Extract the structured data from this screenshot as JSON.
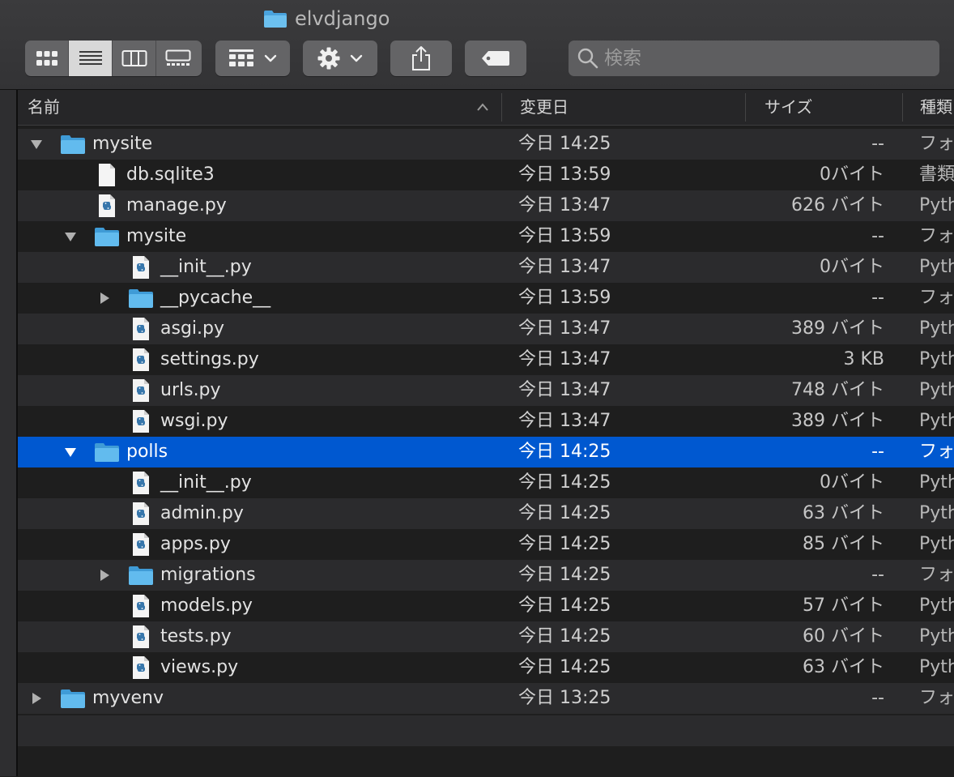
{
  "window": {
    "title": "elvdjango"
  },
  "search": {
    "placeholder": "検索"
  },
  "columns": {
    "name": "名前",
    "date": "変更日",
    "size": "サイズ",
    "kind": "種類"
  },
  "rows": [
    {
      "name": "mysite",
      "date": "今日 14:25",
      "size": "--",
      "kind": "フォルダ",
      "type": "folder",
      "depth": 0,
      "disclosure": "open"
    },
    {
      "name": "db.sqlite3",
      "date": "今日 13:59",
      "size": "0バイト",
      "kind": "書類",
      "type": "document",
      "depth": 1,
      "disclosure": ""
    },
    {
      "name": "manage.py",
      "date": "今日 13:47",
      "size": "626 バイト",
      "kind": "Python",
      "type": "python",
      "depth": 1,
      "disclosure": ""
    },
    {
      "name": "mysite",
      "date": "今日 13:59",
      "size": "--",
      "kind": "フォルダ",
      "type": "folder",
      "depth": 1,
      "disclosure": "open"
    },
    {
      "name": "__init__.py",
      "date": "今日 13:47",
      "size": "0バイト",
      "kind": "Python",
      "type": "python",
      "depth": 2,
      "disclosure": ""
    },
    {
      "name": "__pycache__",
      "date": "今日 13:59",
      "size": "--",
      "kind": "フォルダ",
      "type": "folder",
      "depth": 2,
      "disclosure": "closed"
    },
    {
      "name": "asgi.py",
      "date": "今日 13:47",
      "size": "389 バイト",
      "kind": "Python",
      "type": "python",
      "depth": 2,
      "disclosure": ""
    },
    {
      "name": "settings.py",
      "date": "今日 13:47",
      "size": "3 KB",
      "kind": "Python",
      "type": "python",
      "depth": 2,
      "disclosure": ""
    },
    {
      "name": "urls.py",
      "date": "今日 13:47",
      "size": "748 バイト",
      "kind": "Python",
      "type": "python",
      "depth": 2,
      "disclosure": ""
    },
    {
      "name": "wsgi.py",
      "date": "今日 13:47",
      "size": "389 バイト",
      "kind": "Python",
      "type": "python",
      "depth": 2,
      "disclosure": ""
    },
    {
      "name": "polls",
      "date": "今日 14:25",
      "size": "--",
      "kind": "フォルダ",
      "type": "folder",
      "depth": 1,
      "disclosure": "open",
      "selected": true
    },
    {
      "name": "__init__.py",
      "date": "今日 14:25",
      "size": "0バイト",
      "kind": "Python",
      "type": "python",
      "depth": 2,
      "disclosure": ""
    },
    {
      "name": "admin.py",
      "date": "今日 14:25",
      "size": "63 バイト",
      "kind": "Python",
      "type": "python",
      "depth": 2,
      "disclosure": ""
    },
    {
      "name": "apps.py",
      "date": "今日 14:25",
      "size": "85 バイト",
      "kind": "Python",
      "type": "python",
      "depth": 2,
      "disclosure": ""
    },
    {
      "name": "migrations",
      "date": "今日 14:25",
      "size": "--",
      "kind": "フォルダ",
      "type": "folder",
      "depth": 2,
      "disclosure": "closed"
    },
    {
      "name": "models.py",
      "date": "今日 14:25",
      "size": "57 バイト",
      "kind": "Python",
      "type": "python",
      "depth": 2,
      "disclosure": ""
    },
    {
      "name": "tests.py",
      "date": "今日 14:25",
      "size": "60 バイト",
      "kind": "Python",
      "type": "python",
      "depth": 2,
      "disclosure": ""
    },
    {
      "name": "views.py",
      "date": "今日 14:25",
      "size": "63 バイト",
      "kind": "Python",
      "type": "python",
      "depth": 2,
      "disclosure": ""
    },
    {
      "name": "myvenv",
      "date": "今日 13:25",
      "size": "--",
      "kind": "フォルダ",
      "type": "folder",
      "depth": 0,
      "disclosure": "closed"
    }
  ],
  "colors": {
    "selection": "#0058d0",
    "folder": "#5fb7e8",
    "background": "#1e1e1e",
    "stripe": "#2b2b2d"
  }
}
